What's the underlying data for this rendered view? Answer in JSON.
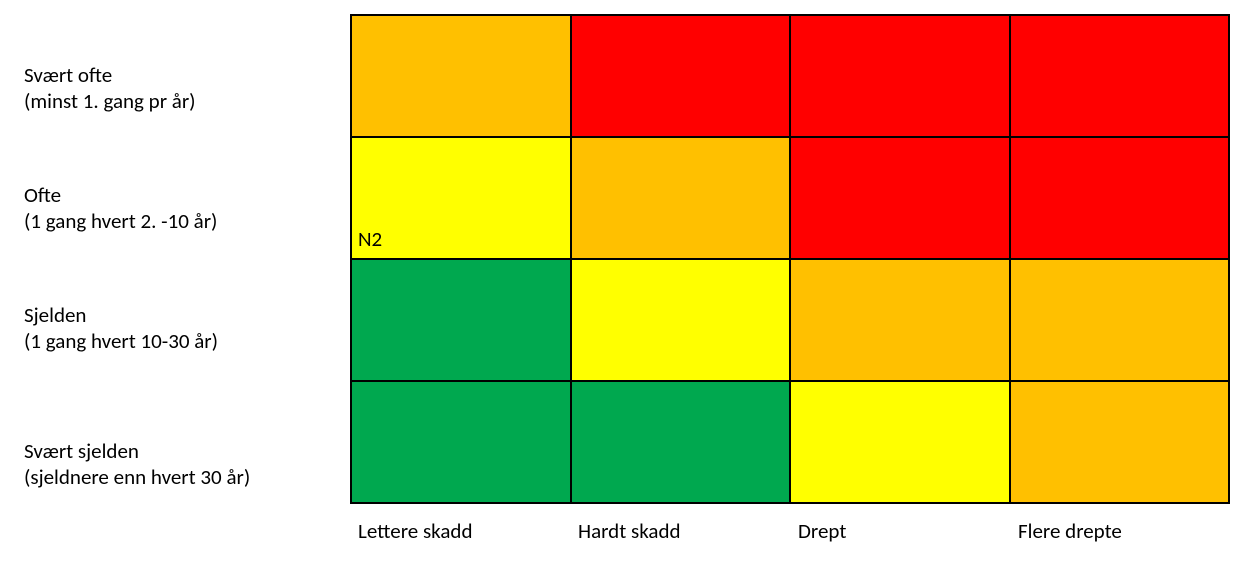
{
  "chart_data": {
    "type": "heatmap",
    "title": "",
    "row_categories": [
      {
        "label": "Svært ofte",
        "sublabel": "(minst 1. gang pr år)"
      },
      {
        "label": "Ofte",
        "sublabel": "(1 gang hvert 2. -10 år)"
      },
      {
        "label": "Sjelden",
        "sublabel": "(1 gang hvert 10-30 år)"
      },
      {
        "label": "Svært sjelden",
        "sublabel": "(sjeldnere enn hvert 30 år)"
      }
    ],
    "col_categories": [
      "Lettere skadd",
      "Hardt skadd",
      "Drept",
      "Flere drepte"
    ],
    "colors": {
      "green": "#00A84F",
      "yellow": "#FFFF00",
      "orange": "#FFC000",
      "red": "#FF0000"
    },
    "grid_colors": [
      [
        "orange",
        "red",
        "red",
        "red"
      ],
      [
        "yellow",
        "orange",
        "red",
        "red"
      ],
      [
        "green",
        "yellow",
        "orange",
        "orange"
      ],
      [
        "green",
        "green",
        "yellow",
        "orange"
      ]
    ],
    "cell_labels": [
      [
        "",
        "",
        "",
        ""
      ],
      [
        "N2",
        "",
        "",
        ""
      ],
      [
        "",
        "",
        "",
        ""
      ],
      [
        "",
        "",
        "",
        ""
      ]
    ]
  }
}
